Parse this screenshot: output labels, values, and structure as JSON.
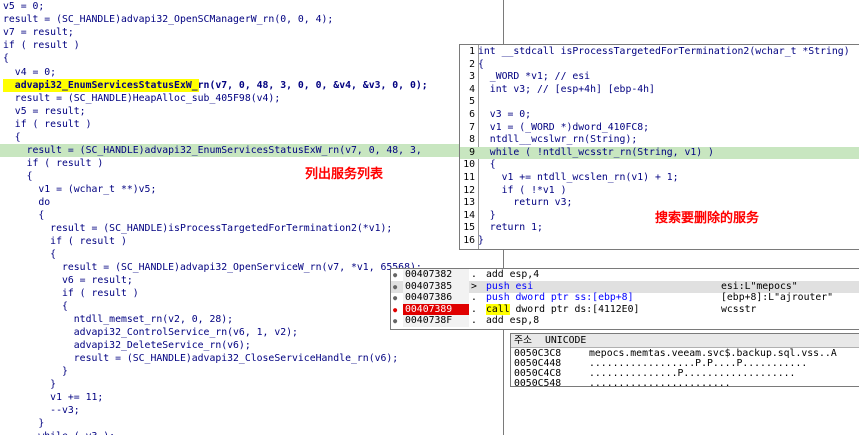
{
  "main_code": {
    "lines": [
      {
        "text": "v5 = 0;"
      },
      {
        "text": "result = (SC_HANDLE)advapi32_OpenSCManagerW_rn(0, 0, 4);"
      },
      {
        "text": "v7 = result;"
      },
      {
        "text": "if ( result )"
      },
      {
        "text": "{"
      },
      {
        "text": "  v4 = 0;"
      },
      {
        "text": "  advapi32_EnumServicesStatusExW_rn(v7, 0, 48, 3, 0, 0, &v4, &v3, 0, 0);"
      },
      {
        "text": "  result = (SC_HANDLE)HeapAlloc_sub_405F98(v4);"
      },
      {
        "text": "  v5 = result;"
      },
      {
        "text": "  if ( result )"
      },
      {
        "text": "  {"
      },
      {
        "text": "    result = (SC_HANDLE)advapi32_EnumServicesStatusExW_rn(v7, 0, 48, 3,"
      },
      {
        "text": "    if ( result )"
      },
      {
        "text": "    {"
      },
      {
        "text": "      v1 = (wchar_t **)v5;"
      },
      {
        "text": "      do"
      },
      {
        "text": "      {"
      },
      {
        "text": "        result = (SC_HANDLE)isProcessTargetedForTermination2(*v1);"
      },
      {
        "text": "        if ( result )"
      },
      {
        "text": "        {"
      },
      {
        "text": "          result = (SC_HANDLE)advapi32_OpenServiceW_rn(v7, *v1, 65568);"
      },
      {
        "text": "          v6 = result;"
      },
      {
        "text": "          if ( result )"
      },
      {
        "text": "          {"
      },
      {
        "text": "            ntdll_memset_rn(v2, 0, 28);"
      },
      {
        "text": "            advapi32_ControlService_rn(v6, 1, v2);"
      },
      {
        "text": "            advapi32_DeleteService_rn(v6);"
      },
      {
        "text": "            result = (SC_HANDLE)advapi32_CloseServiceHandle_rn(v6);"
      },
      {
        "text": "          }"
      },
      {
        "text": "        }"
      },
      {
        "text": "        v1 += 11;"
      },
      {
        "text": "        --v3;"
      },
      {
        "text": "      }"
      },
      {
        "text": "      while ( v3 );"
      }
    ]
  },
  "annotations": {
    "list_services": "列出服务列表",
    "search_delete_services": "搜索要删除的服务"
  },
  "side_code": {
    "lines": [
      {
        "no": "1",
        "text": "int __stdcall isProcessTargetedForTermination2(wchar_t *String)"
      },
      {
        "no": "2",
        "text": "{"
      },
      {
        "no": "3",
        "text": "  _WORD *v1; // esi"
      },
      {
        "no": "4",
        "text": "  int v3; // [esp+4h] [ebp-4h]"
      },
      {
        "no": "5",
        "text": ""
      },
      {
        "no": "6",
        "text": "  v3 = 0;"
      },
      {
        "no": "7",
        "text": "  v1 = (_WORD *)dword_410FC8;"
      },
      {
        "no": "8",
        "text": "  ntdll__wcslwr_rn(String);"
      },
      {
        "no": "9",
        "text": "  while ( !ntdll_wcsstr_rn(String, v1) )"
      },
      {
        "no": "10",
        "text": "  {"
      },
      {
        "no": "11",
        "text": "    v1 += ntdll_wcslen_rn(v1) + 1;"
      },
      {
        "no": "12",
        "text": "    if ( !*v1 )"
      },
      {
        "no": "13",
        "text": "      return v3;"
      },
      {
        "no": "14",
        "text": "  }"
      },
      {
        "no": "15",
        "text": "  return 1;"
      },
      {
        "no": "16",
        "text": "}"
      }
    ]
  },
  "disasm": {
    "rows": [
      {
        "addr": "00407382",
        "sep": ".",
        "mnemonic": "add",
        "operands": "esp,4",
        "comment": ""
      },
      {
        "addr": "00407385",
        "sep": ">",
        "mnemonic": "push",
        "operands": "esi",
        "comment": "esi:L\"mepocs\""
      },
      {
        "addr": "00407386",
        "sep": ".",
        "mnemonic": "push",
        "operands": "dword ptr ss:[ebp+8]",
        "comment": "[ebp+8]:L\"ajrouter\""
      },
      {
        "addr": "00407389",
        "sep": ".",
        "mnemonic": "call",
        "operands": "dword ptr ds:[4112E0]",
        "comment": "wcsstr"
      },
      {
        "addr": "0040738F",
        "sep": ".",
        "mnemonic": "add",
        "operands": "esp,8",
        "comment": ""
      }
    ]
  },
  "dump": {
    "header_addr": "주소",
    "header_text": "UNICODE",
    "rows": [
      {
        "addr": "0050C3C8",
        "text": "mepocs.memtas.veeam.svc$.backup.sql.vss..A"
      },
      {
        "addr": "0050C448",
        "text": "..................P.P....P..........."
      },
      {
        "addr": "0050C4C8",
        "text": "...............P..................."
      },
      {
        "addr": "0050C548",
        "text": "........................"
      }
    ]
  }
}
